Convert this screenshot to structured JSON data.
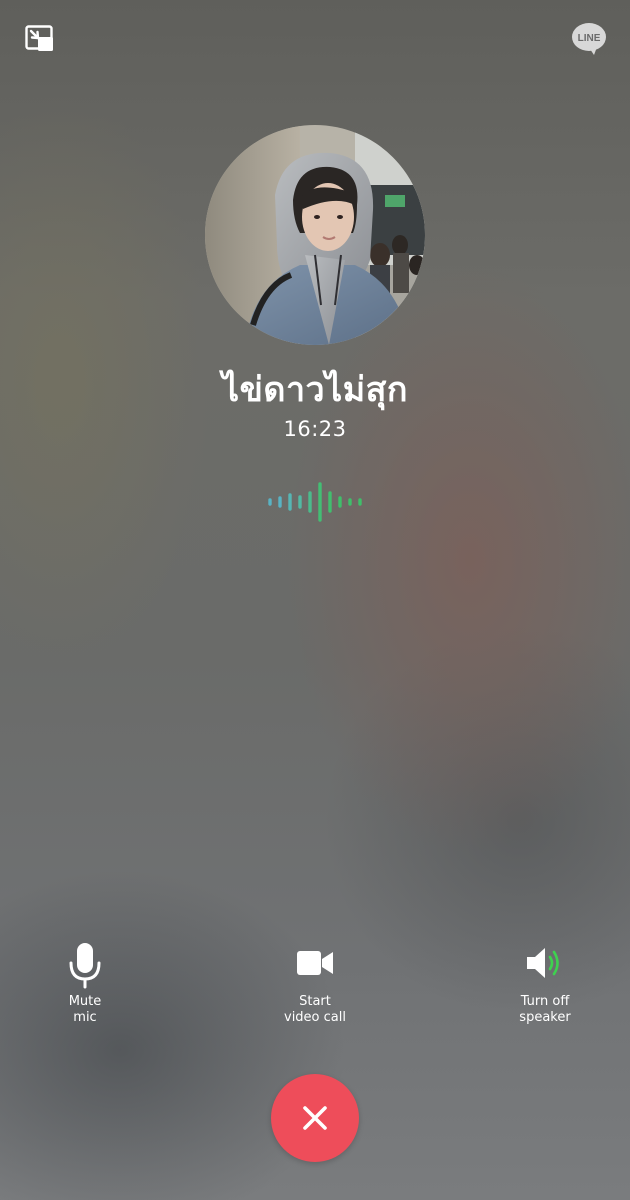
{
  "caller": {
    "name": "ไข่ดาวไม่สุก",
    "timer": "16:23"
  },
  "controls": {
    "mute_label": "Mute\nmic",
    "video_label": "Start\nvideo call",
    "speaker_label": "Turn off\nspeaker"
  },
  "icons": {
    "minimize": "minimize-window-icon",
    "brand": "line-logo-icon",
    "mic": "microphone-icon",
    "video": "video-camera-icon",
    "speaker": "speaker-on-icon",
    "end": "close-x-icon"
  },
  "brand": {
    "logo_text": "LINE"
  },
  "colors": {
    "end_call": "#ee4d5a",
    "waveform_teal": "#59b3c4",
    "waveform_green": "#3fbf6a",
    "speaker_active": "#3ed14f"
  }
}
